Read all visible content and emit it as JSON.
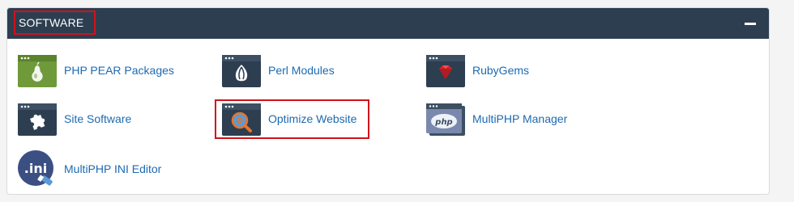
{
  "section": {
    "title": "SOFTWARE",
    "collapse_icon": "minus-icon"
  },
  "items": [
    {
      "label": "PHP PEAR Packages",
      "icon": "php-pear-icon"
    },
    {
      "label": "Perl Modules",
      "icon": "perl-onion-icon"
    },
    {
      "label": "RubyGems",
      "icon": "ruby-gem-icon"
    },
    {
      "label": "Site Software",
      "icon": "puzzle-piece-icon"
    },
    {
      "label": "Optimize Website",
      "icon": "magnifier-gear-icon"
    },
    {
      "label": "MultiPHP Manager",
      "icon": "php-logo-icon"
    },
    {
      "label": "MultiPHP INI Editor",
      "icon": "ini-file-icon"
    }
  ],
  "colors": {
    "header_bg": "#2d3e50",
    "link": "#1d6ab1",
    "highlight": "#d0121b"
  }
}
